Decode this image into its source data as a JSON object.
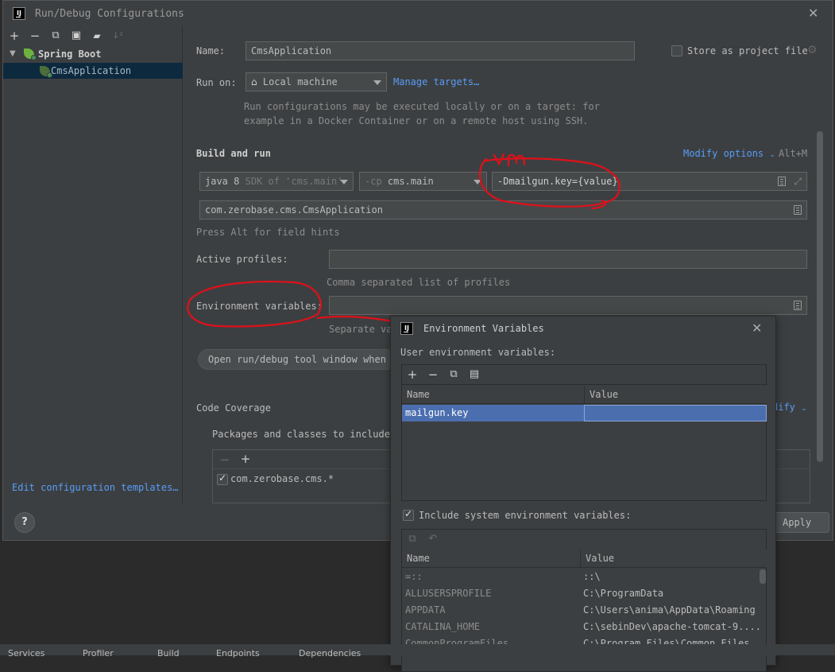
{
  "window": {
    "title": "Run/Debug Configurations",
    "logo": "IJ"
  },
  "toolbar": {
    "add": "+",
    "remove": "−",
    "copy": "⧉",
    "save": "▣",
    "folder": "▰",
    "sort": "↓²"
  },
  "tree": {
    "group_label": "Spring Boot",
    "item_label": "CmsApplication"
  },
  "left_footer": {
    "edit_templates": "Edit configuration templates…",
    "help": "?"
  },
  "form": {
    "name_label": "Name:",
    "name_value": "CmsApplication",
    "store_label": "Store as project file",
    "run_on_label": "Run on:",
    "run_on_value": "Local machine",
    "manage_targets": "Manage targets…",
    "run_on_hint_1": "Run configurations may be executed locally or on a target: for",
    "run_on_hint_2": "example in a Docker Container or on a remote host using SSH.",
    "build_and_run": "Build and run",
    "modify_options": "Modify options",
    "modify_shortcut": "Alt+M",
    "jdk_name": "java 8",
    "jdk_suffix": "SDK of 'cms.main'",
    "cp_flag": "-cp",
    "cp_value": "cms.main",
    "vm_options": "-Dmailgun.key={value}",
    "main_class": "com.zerobase.cms.CmsApplication",
    "field_hints": "Press Alt for field hints",
    "active_profiles_label": "Active profiles:",
    "active_profiles_hint": "Comma separated list of profiles",
    "env_vars_label": "Environment variables:",
    "env_vars_hint": "Separate va",
    "open_tool_window": "Open run/debug tool window when s",
    "code_coverage": "Code Coverage",
    "modify_partial": "dify",
    "packages_label": "Packages and classes to include",
    "package_entry": "com.zerobase.cms.*",
    "apply": "Apply"
  },
  "annotation": {
    "handwritten": "vm"
  },
  "popup": {
    "title": "Environment Variables",
    "user_label": "User environment variables:",
    "col_name": "Name",
    "col_value": "Value",
    "user_rows": [
      {
        "name": "mailgun.key",
        "value": ""
      }
    ],
    "include_system_label": "Include system environment variables:",
    "system_rows": [
      {
        "name": "=::",
        "value": "::\\"
      },
      {
        "name": "ALLUSERSPROFILE",
        "value": "C:\\ProgramData"
      },
      {
        "name": "APPDATA",
        "value": "C:\\Users\\anima\\AppData\\Roaming"
      },
      {
        "name": "CATALINA_HOME",
        "value": "C:\\sebinDev\\apache-tomcat-9...."
      },
      {
        "name": "CommonProgramFiles",
        "value": "C:\\Program Files\\Common Files"
      }
    ]
  },
  "statusbar": {
    "items": [
      "Services",
      "Profiler",
      "Build",
      "Endpoints",
      "Dependencies"
    ]
  },
  "colors": {
    "background": "#3c3f41",
    "selection": "#4b6eaf",
    "link": "#589df6",
    "annotation": "#e0101a"
  }
}
